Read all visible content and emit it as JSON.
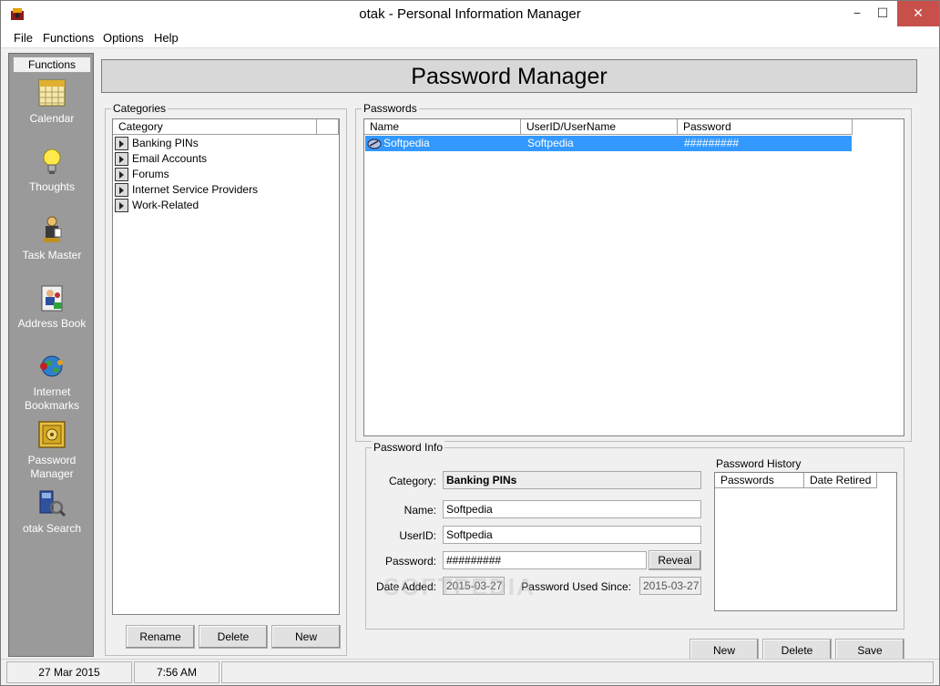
{
  "window": {
    "title": "otak - Personal Information Manager",
    "minimize_glyph": "−",
    "maximize_glyph": "☐",
    "close_glyph": "✕"
  },
  "menu": [
    "File",
    "Functions",
    "Options",
    "Help"
  ],
  "functions": {
    "header": "Functions",
    "items": [
      {
        "label": "Calendar",
        "icon": "calendar-icon"
      },
      {
        "label": "Thoughts",
        "icon": "lightbulb-icon"
      },
      {
        "label": "Task Master",
        "icon": "task-master-icon"
      },
      {
        "label": "Address Book",
        "icon": "address-book-icon"
      },
      {
        "label": "Internet Bookmarks",
        "icon": "globe-icon"
      },
      {
        "label": "Password Manager",
        "icon": "safe-icon"
      },
      {
        "label": "otak Search",
        "icon": "search-icon"
      }
    ]
  },
  "page": {
    "title": "Password Manager"
  },
  "categories": {
    "group_label": "Categories",
    "column": "Category",
    "items": [
      "Banking PINs",
      "Email Accounts",
      "Forums",
      "Internet Service Providers",
      "Work-Related"
    ],
    "buttons": {
      "rename": "Rename",
      "delete": "Delete",
      "new": "New"
    }
  },
  "passwords": {
    "group_label": "Passwords",
    "columns": {
      "name": "Name",
      "userid": "UserID/UserName",
      "password": "Password"
    },
    "rows": [
      {
        "name": "Softpedia",
        "userid": "Softpedia",
        "password": "#########"
      }
    ]
  },
  "password_info": {
    "group_label": "Password Info",
    "category_label": "Category:",
    "category_value": "Banking PINs",
    "name_label": "Name:",
    "name_value": "Softpedia",
    "userid_label": "UserID:",
    "userid_value": "Softpedia",
    "password_label": "Password:",
    "password_value": "#########",
    "reveal_button": "Reveal",
    "date_added_label": "Date Added:",
    "date_added_value": "2015-03-27",
    "used_since_label": "Password Used Since:",
    "used_since_value": "2015-03-27"
  },
  "history": {
    "label": "Password History",
    "columns": {
      "passwords": "Passwords",
      "date_retired": "Date Retired"
    }
  },
  "bottom_buttons": {
    "new": "New",
    "delete": "Delete",
    "save": "Save"
  },
  "status": {
    "date": "27 Mar 2015",
    "time": "7:56 AM"
  },
  "watermark": "SOFTPEDIA"
}
